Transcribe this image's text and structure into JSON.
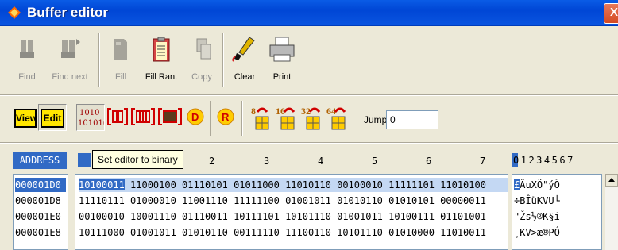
{
  "window": {
    "title": "Buffer editor",
    "close_label": "X"
  },
  "toolbar": {
    "find": "Find",
    "find_next": "Find next",
    "fill": "Fill",
    "fill_random": "Fill Ran.",
    "copy": "Copy",
    "clear": "Clear",
    "print": "Print"
  },
  "toolbar2": {
    "view": "View",
    "edit": "Edit",
    "binary_icon_text": [
      "1010",
      "10101("
    ],
    "hex_mode_label": "D",
    "r_label": "R",
    "width_buttons": [
      "8",
      "16",
      "32",
      "64"
    ],
    "jump_label": "Jump",
    "jump_value": "0"
  },
  "grid": {
    "address_header": "ADDRESS",
    "tooltip": "Set editor to binary",
    "column_headers": [
      "2",
      "3",
      "4",
      "5",
      "6",
      "7"
    ],
    "char_header": "01234567",
    "rows": [
      {
        "address": "000001D0",
        "data": "10100011 11000100 01110101 01011000 11010110 00100010 11111101 11010100",
        "first_cell": "10100011",
        "rest": " 11000100 01110101 01011000 11010110 00100010 11111101 11010100",
        "chars": "£ÄuXÖ\"ýÔ"
      },
      {
        "address": "000001D8",
        "data": "11110111 01000010 11001110 11111100 01001011 01010110 01010101 00000011",
        "chars": "÷BÎüKVU└"
      },
      {
        "address": "000001E0",
        "data": "00100010 10001110 01110011 10111101 10101110 01001011 10100111 01101001",
        "chars": "\"Žs½®K§i"
      },
      {
        "address": "000001E8",
        "data": "10111000 01001011 01010110 00111110 11100110 10101110 01010000 11010011",
        "chars": "¸KV>æ®PÓ"
      }
    ]
  },
  "colors": {
    "title_bar": "#0a5ce6",
    "selection": "#316ac5",
    "button_yellow": "#ffe600",
    "close_red": "#d44a22"
  }
}
